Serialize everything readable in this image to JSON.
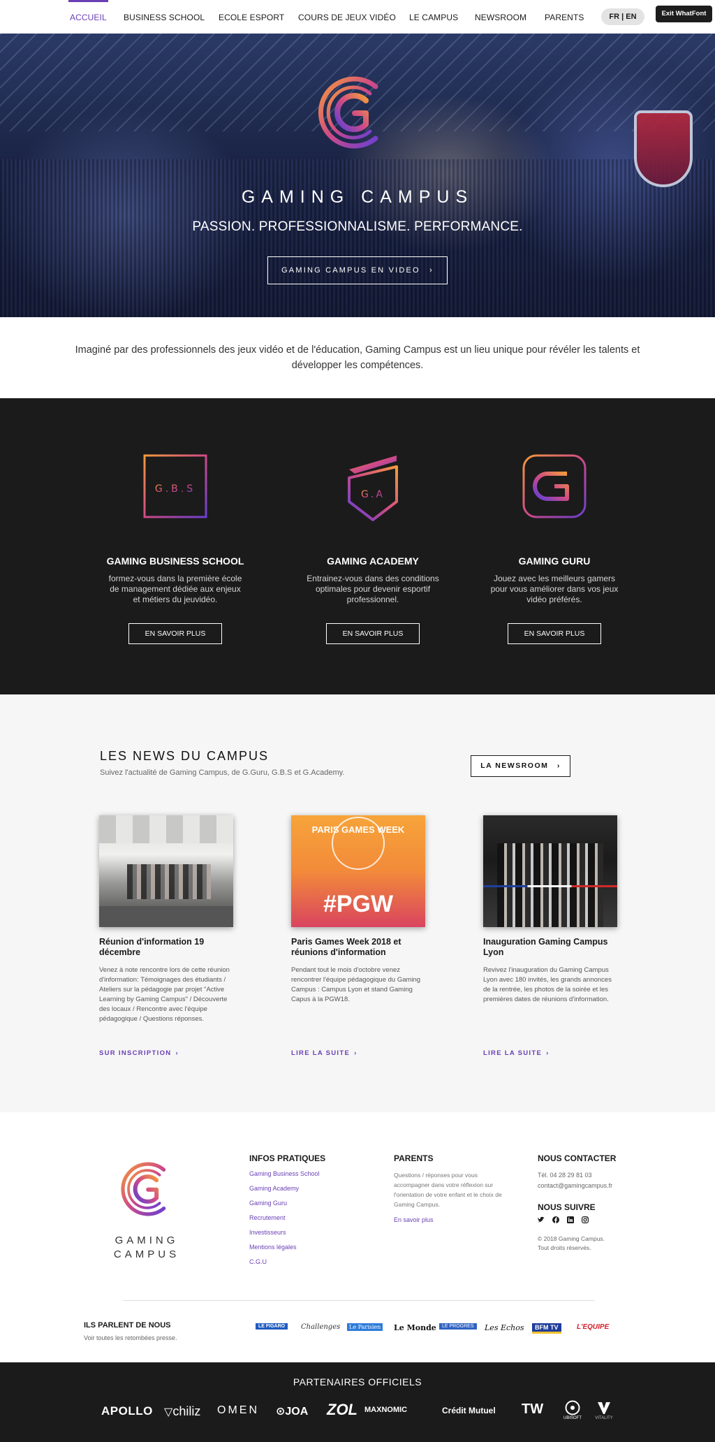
{
  "nav": {
    "items": [
      "ACCUEIL",
      "BUSINESS SCHOOL",
      "ECOLE ESPORT",
      "COURS DE JEUX VIDÉO",
      "LE CAMPUS",
      "NEWSROOM",
      "PARENTS"
    ],
    "lang": "FR | EN",
    "whatfont": "Exit WhatFont"
  },
  "hero": {
    "title": "GAMING CAMPUS",
    "tagline": "PASSION. PROFESSIONNALISME. PERFORMANCE.",
    "button": "GAMING CAMPUS EN VIDEO"
  },
  "intro": "Imaginé par des professionnels des jeux vidéo et de l'éducation, Gaming Campus est un lieu unique pour révéler les talents et développer les compétences.",
  "schools": [
    {
      "logo_text": "G.B.S",
      "title": "GAMING BUSINESS SCHOOL",
      "text": "formez-vous dans la première école de management dédiée aux enjeux et métiers du jeuvidéo.",
      "button": "EN SAVOIR PLUS"
    },
    {
      "logo_text": "G.A",
      "title": "GAMING ACADEMY",
      "text": "Entrainez-vous dans des conditions optimales pour devenir esportif professionnel.",
      "button": "EN SAVOIR PLUS"
    },
    {
      "title": "GAMING GURU",
      "text": "Jouez avec les meilleurs gamers pour vous améliorer dans vos jeux vidéo préférés.",
      "button": "EN SAVOIR PLUS"
    }
  ],
  "news": {
    "title": "LES NEWS DU CAMPUS",
    "subtitle": "Suivez l'actualité de Gaming Campus, de G.Guru, G.B.S et G.Academy.",
    "newsroom_button": "LA NEWSROOM",
    "cards": [
      {
        "title": "Réunion d'information 19 décembre",
        "text": "Venez à note rencontre lors de cette réunion d'information: Témoignages des étudiants / Ateliers sur la pédagogie par projet \"Active Learning by Gaming Campus\" / Découverte des locaux / Rencontre avec l'équipe pédagogique / Questions réponses.",
        "link": "SUR INSCRIPTION"
      },
      {
        "title": "Paris Games Week 2018 et réunions d'information",
        "text": "Pendant tout le mois d'octobre venez rencontrer l'équipe pédagogique du Gaming Campus : Campus Lyon et stand Gaming Capus à la PGW18.",
        "link": "LIRE LA SUITE",
        "img_top": "PARIS GAMES WEEK",
        "img_tag": "#PGW"
      },
      {
        "title": "Inauguration Gaming Campus Lyon",
        "text": "Revivez l'inauguration du Gaming Campus Lyon avec 180 invités, les grands annonces de la rentrée, les photos de la soirée et les premières dates de réunions d'information.",
        "link": "LIRE LA SUITE"
      }
    ]
  },
  "footer": {
    "brand": "GAMING CAMPUS",
    "infos_title": "INFOS PRATIQUES",
    "infos_links": [
      "Gaming Business School",
      "Gaming Academy",
      "Gaming Guru",
      "Recrutement",
      "Investisseurs",
      "Mentions légales",
      "C.G.U"
    ],
    "parents_title": "PARENTS",
    "parents_text": "Questions / réponses pour vous accompagner dans votre réflexion sur l'orientation de votre enfant et le choix de Gaming Campus.",
    "parents_link": "En savoir plus",
    "contact_title": "NOUS CONTACTER",
    "phone": "Tél. 04 28 29 81 03",
    "email": "contact@gamingcampus.fr",
    "follow_title": "NOUS SUIVRE",
    "copyright_1": "© 2018 Gaming Campus.",
    "copyright_2": "Tout droits réservés.",
    "press_title": "ILS PARLENT DE NOUS",
    "press_sub": "Voir toutes les retombées presse.",
    "press_logos": [
      "LE FIGARO",
      "Challenges",
      "Le Parisien",
      "Le Monde",
      "LE PROGRES",
      "Les Echos",
      "BFM TV",
      "L'EQUIPE"
    ]
  },
  "partners": {
    "title": "PARTENAIRES OFFICIELS",
    "logos": [
      "APOLLO",
      "chiliz",
      "OMEN",
      "JOA",
      "ZOL",
      "MAXNOMIC",
      "Crédit Mutuel",
      "TW",
      "UBISOFT",
      "VITALITY"
    ]
  },
  "colors": {
    "accent": "#6a3fb5",
    "dark": "#1b1b1b",
    "gradient_orange": "#f28a3a",
    "gradient_purple": "#7b3fd0"
  }
}
